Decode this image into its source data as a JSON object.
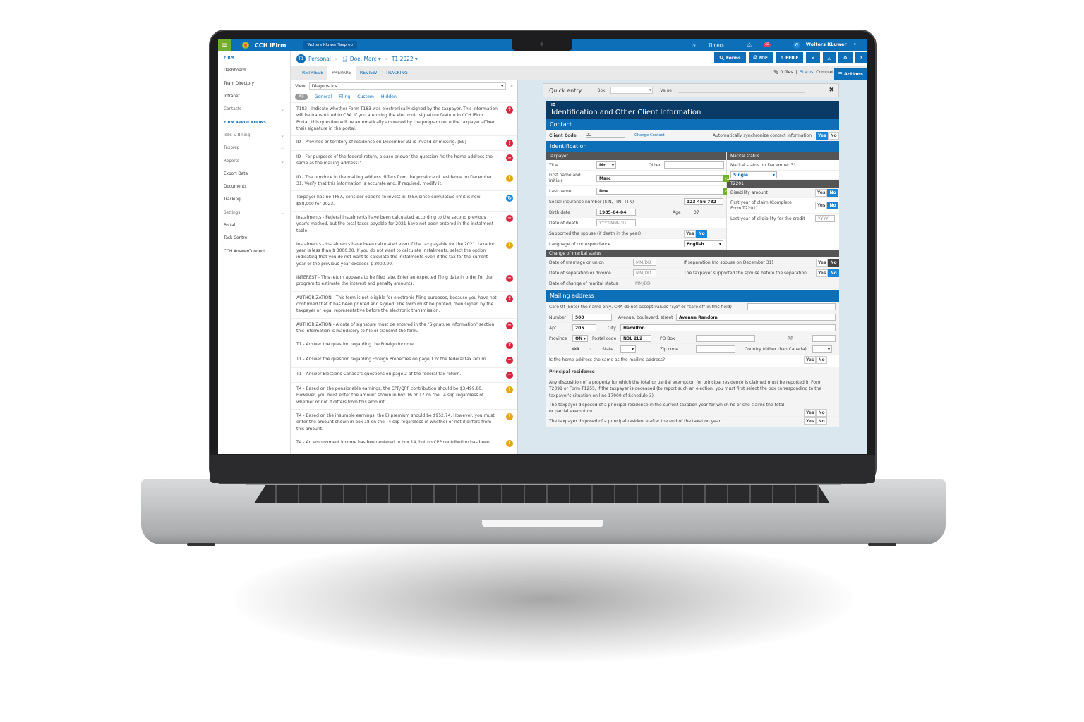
{
  "topbar": {
    "app_name": "CCH iFirm",
    "product": "Wolters Kluwer Taxprep",
    "timers": "Timers",
    "notifications_count": "32",
    "user_initial": "W",
    "user_name": "Wolters KLuwer"
  },
  "sidebar": {
    "items": [
      {
        "label": "FIRM",
        "type": "section"
      },
      {
        "label": "Dashboard"
      },
      {
        "label": "Team Directory"
      },
      {
        "label": "Intranet"
      },
      {
        "label": "Contacts",
        "expandable": true
      },
      {
        "label": "FIRM APPLICATIONS",
        "type": "section"
      },
      {
        "label": "Jobs & Billing",
        "expandable": true
      },
      {
        "label": "Taxprep",
        "expandable": true
      },
      {
        "label": "Reports",
        "expandable": true
      },
      {
        "label": "Export Data"
      },
      {
        "label": "Documents"
      },
      {
        "label": "Tracking"
      },
      {
        "label": "Settings",
        "expandable": true
      },
      {
        "label": "Portal"
      },
      {
        "label": "Task Centre"
      },
      {
        "label": "CCH AnswerConnect"
      }
    ]
  },
  "breadcrumb": {
    "badge": "T1",
    "personal": "Personal",
    "client": "Doe, Marc",
    "year": "T1 2022"
  },
  "toolbar": {
    "forms": "Forms",
    "pdf": "PDF",
    "efile": "EFILE",
    "help": "?"
  },
  "tabs": [
    "RETRIEVE",
    "PREPARE",
    "REVIEW",
    "TRACKING"
  ],
  "active_tab": "PREPARE",
  "status": {
    "files": "0 files",
    "status_label": "Status:",
    "status_value": "Completed",
    "actions": "Actions"
  },
  "diagnostics": {
    "view_label": "View",
    "view_value": "Diagnostics",
    "filters": [
      "All",
      "General",
      "Filing",
      "Custom",
      "Hidden"
    ],
    "items": [
      {
        "text": "T183 - Indicate whether Form T183 was electronically signed by the taxpayer. This information will be transmitted to CRA. If you are using the electronic signature feature in CCH iFirm Portal, this question will be automatically answered by the program once the taxpayer affixed their signature in the portal.",
        "severity": "efile"
      },
      {
        "text": "ID - Province or territory of residence on December 31 is invalid or missing. [59]",
        "severity": "efile"
      },
      {
        "text": "ID - For purposes of the federal return, please answer the question \"Is the home address the same as the mailing address?\"",
        "severity": "error"
      },
      {
        "text": "ID - The province in the mailing address differs from the province of residence on December 31. Verify that this information is accurate and, if required, modify it.",
        "severity": "warning"
      },
      {
        "text": "Taxpayer has no TFSA, consider options to invest in TFSA since cumulative limit is now $88,000 for 2023.",
        "severity": "info"
      },
      {
        "text": "Instalments - Federal instalments have been calculated according to the second previous year's method, but the total taxes payable for 2021 have not been entered in the instalment table.",
        "severity": "error"
      },
      {
        "text": "Instalments - Instalments have been calculated even if the tax payable for the 2021: taxation year is less than $ 3000.00. If you do not want to calculate instalments, select the option indicating that you do not want to calculate the instalments even if the tax for the current year or the previous year exceeds $ 3000.00.",
        "severity": "warning"
      },
      {
        "text": "INTEREST - This return appears to be filed late. Enter an expected filing date in order for the program to estimate the interest and penalty amounts.",
        "severity": "error"
      },
      {
        "text": "AUTHORIZATION - This form is not eligible for electronic filing purposes, because you have not confirmed that it has been printed and signed. The form must be printed, then signed by the taxpayer or legal representative before the electronic transmission.",
        "severity": "efile"
      },
      {
        "text": "AUTHORIZATION - A date of signature must be entered in the \"Signature information\" section; this information is mandatory to file or transmit the form.",
        "severity": "error"
      },
      {
        "text": "T1 - Answer the question regarding the Foreign income.",
        "severity": "efile"
      },
      {
        "text": "T1 - Answer the question regarding Foreign Properties on page 1 of the federal tax return.",
        "severity": "error"
      },
      {
        "text": "T1 - Answer Elections Canada's questions on page 2 of the federal tax return.",
        "severity": "error"
      },
      {
        "text": "T4 - Based on the pensionable earnings, the CPP/QPP contribution should be $3,499.80. However, you must enter the amount shown in box 16 or 17 on the T4 slip regardless of whether or not if differs from this amount.",
        "severity": "warning"
      },
      {
        "text": "T4 - Based on the insurable earnings, the EI premium should be $952.74. However, you must enter the amount shown in box 18 on the T4 slip regardless of whether or not if differs from this amount.",
        "severity": "warning"
      },
      {
        "text": "T4 - An employment income has been entered in box 14, but no CPP contribution has been",
        "severity": "warning"
      }
    ]
  },
  "severity_colors": {
    "efile": "#d7263d",
    "error": "#d7263d",
    "warning": "#e8a317",
    "info": "#1b86d7"
  },
  "quick_entry": {
    "title": "Quick entry",
    "box_label": "Box",
    "value_label": "Value"
  },
  "form": {
    "code": "ID",
    "title": "Identification and Other Client Information",
    "contact": {
      "header": "Contact",
      "client_code_label": "Client Code",
      "client_code": "22",
      "change_contact": "Change Contact",
      "sync_label": "Automatically synchronize contact information",
      "sync_value": "Yes"
    },
    "identification": {
      "header": "Identification",
      "taxpayer_header": "Taxpayer",
      "title_label": "Title",
      "title_value": "Mr",
      "other_label": "Other",
      "first_name_label": "First name and initials",
      "first_name": "Marc",
      "last_name_label": "Last name",
      "last_name": "Doe",
      "sin_label": "Social insurance number (SIN, ITN, TTN)",
      "sin": "123 456 782",
      "birth_label": "Birth date",
      "birth": "1985-04-04",
      "age_label": "Age",
      "age": "37",
      "death_label": "Date of death",
      "death_placeholder": "YYYY-MM-DD",
      "spouse_label": "Supported the spouse (if death in the year)",
      "spouse_value": "No",
      "lang_label": "Language of correspondence",
      "lang": "English",
      "marital_header": "Marital status",
      "marital_label": "Marital status on December 31",
      "marital_value": "Single",
      "t2201_header": "T2201",
      "disability_label": "Disability amount",
      "disability_value": "No",
      "first_year_label": "First year of claim (Complete Form T2201)",
      "first_year_value": "No",
      "last_year_label": "Last year of eligibility for the credit",
      "last_year_placeholder": "YYYY"
    },
    "marital_change": {
      "header": "Change of marital status",
      "marriage_label": "Date of marriage or union",
      "separation_label": "Date of separation or divorce",
      "change_label": "Date of change of marital status",
      "date_placeholder": "MM/DD",
      "if_sep_label": "If separation (no spouse on December 31)",
      "if_sep_value": "No",
      "supported_label": "The taxpayer supported the spouse before the separation",
      "supported_value": "No"
    },
    "mailing": {
      "header": "Mailing address",
      "care_of_label": "Care Of (Enter the name only, CRA do not accept values \"c/o\" or \"care of\" in this field)",
      "number_label": "Number",
      "number": "500",
      "street_label": "Avenue, boulevard, street",
      "street": "Avenue Random",
      "apt_label": "Apt.",
      "apt": "205",
      "city_label": "City",
      "city": "Hamilton",
      "province_label": "Province",
      "province": "ON",
      "postal_label": "Postal code",
      "postal": "N3L 2L2",
      "pobox_label": "PO Box",
      "rr_label": "RR",
      "or_label": "OR",
      "state_label": "State",
      "zip_label": "Zip code",
      "country_label": "Country (Other than Canada)",
      "home_same_label": "Is the home address the same as the mailing address?"
    },
    "principal": {
      "header": "Principal residence",
      "note": "Any disposition of a property for which the total or partial exemption for principal residence is claimed must be reported in Form T2091 or Form T1255, if the taxpayer is deceased (to report such an election, you must first select the box corresponding to the taxpayer's situation on line 17900 of Schedule 3).",
      "q1": "The taxpayer disposed of a principal residence in the current taxation year for which he or she claims the total or partial exemption.",
      "q2": "The taxpayer disposed of a principal residence after the end of the taxation year."
    },
    "yes": "Yes",
    "no": "No"
  }
}
